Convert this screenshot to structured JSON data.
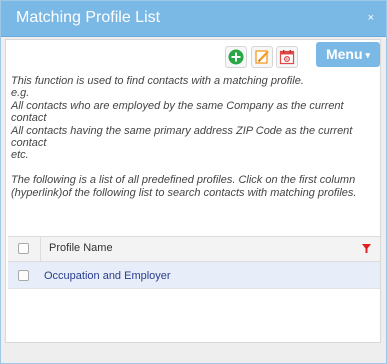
{
  "dialog": {
    "title": "Matching Profile List",
    "close_icon": "×"
  },
  "toolbar": {
    "icons": [
      "add-icon",
      "edit-icon",
      "calendar-settings-icon"
    ],
    "menu_label": "Menu",
    "menu_caret": "▾",
    "colors": {
      "accent": "#7ab8e6",
      "add": "#27a844",
      "edit": "#f59a23",
      "calendar": "#e04848"
    }
  },
  "description": {
    "line1": "This function is used to find contacts with a matching profile.",
    "line2": "e.g.",
    "line3": "All contacts who are employed by the same Company as the current contact",
    "line4": "All contacts having the same primary address ZIP Code as the current contact",
    "line5": "etc.",
    "line6": "The following is a list of all predefined profiles. Click on the first column (hyperlink)of the following list to search contacts with matching profiles."
  },
  "grid": {
    "column_header": "Profile Name",
    "filter_icon": "filter-icon",
    "rows": [
      {
        "profile_name": "Occupation and Employer",
        "selected": false
      }
    ]
  }
}
